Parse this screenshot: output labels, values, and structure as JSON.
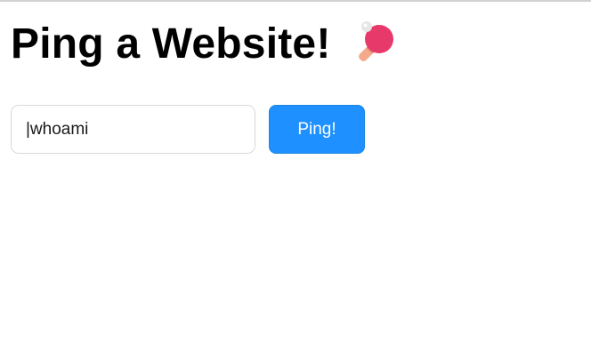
{
  "page": {
    "title": "Ping a Website!",
    "title_icon": "ping-pong-paddle-icon"
  },
  "form": {
    "input_value": "|whoami",
    "button_label": "Ping!"
  },
  "colors": {
    "button_bg": "#1e90ff",
    "paddle_red": "#e8396b",
    "paddle_handle": "#f3a98a",
    "ball": "#e6e6e6"
  }
}
